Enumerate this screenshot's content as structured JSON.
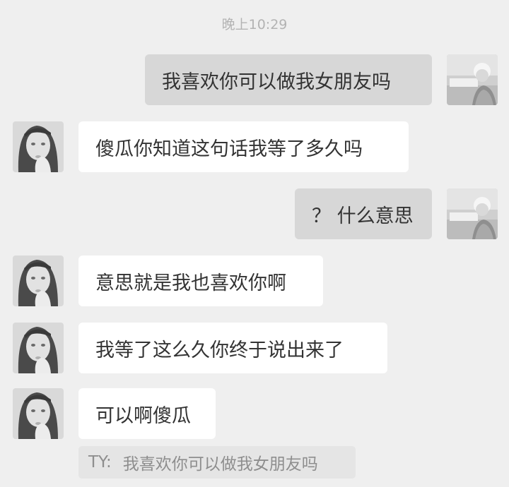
{
  "chat": {
    "timestamp": "晚上10:29",
    "messages": [
      {
        "sender": "self",
        "text": "我喜欢你可以做我女朋友吗"
      },
      {
        "sender": "other",
        "text": "傻瓜你知道这句话我等了多久吗"
      },
      {
        "sender": "self",
        "text": "？ 什么意思"
      },
      {
        "sender": "other",
        "text": "意思就是我也喜欢你啊"
      },
      {
        "sender": "other",
        "text": "我等了这么久你终于说出来了"
      },
      {
        "sender": "other",
        "text": "可以啊傻瓜"
      }
    ],
    "quote": {
      "author": "TY:",
      "text": "我喜欢你可以做我女朋友吗"
    }
  },
  "avatars": {
    "self": "boy-avatar",
    "other": "girl-avatar"
  },
  "colors": {
    "background": "#efefef",
    "self_bubble": "#d7d7d7",
    "other_bubble": "#ffffff",
    "quote_bubble": "#e5e5e5",
    "text": "#333333",
    "muted_text": "#b3b3b3"
  }
}
